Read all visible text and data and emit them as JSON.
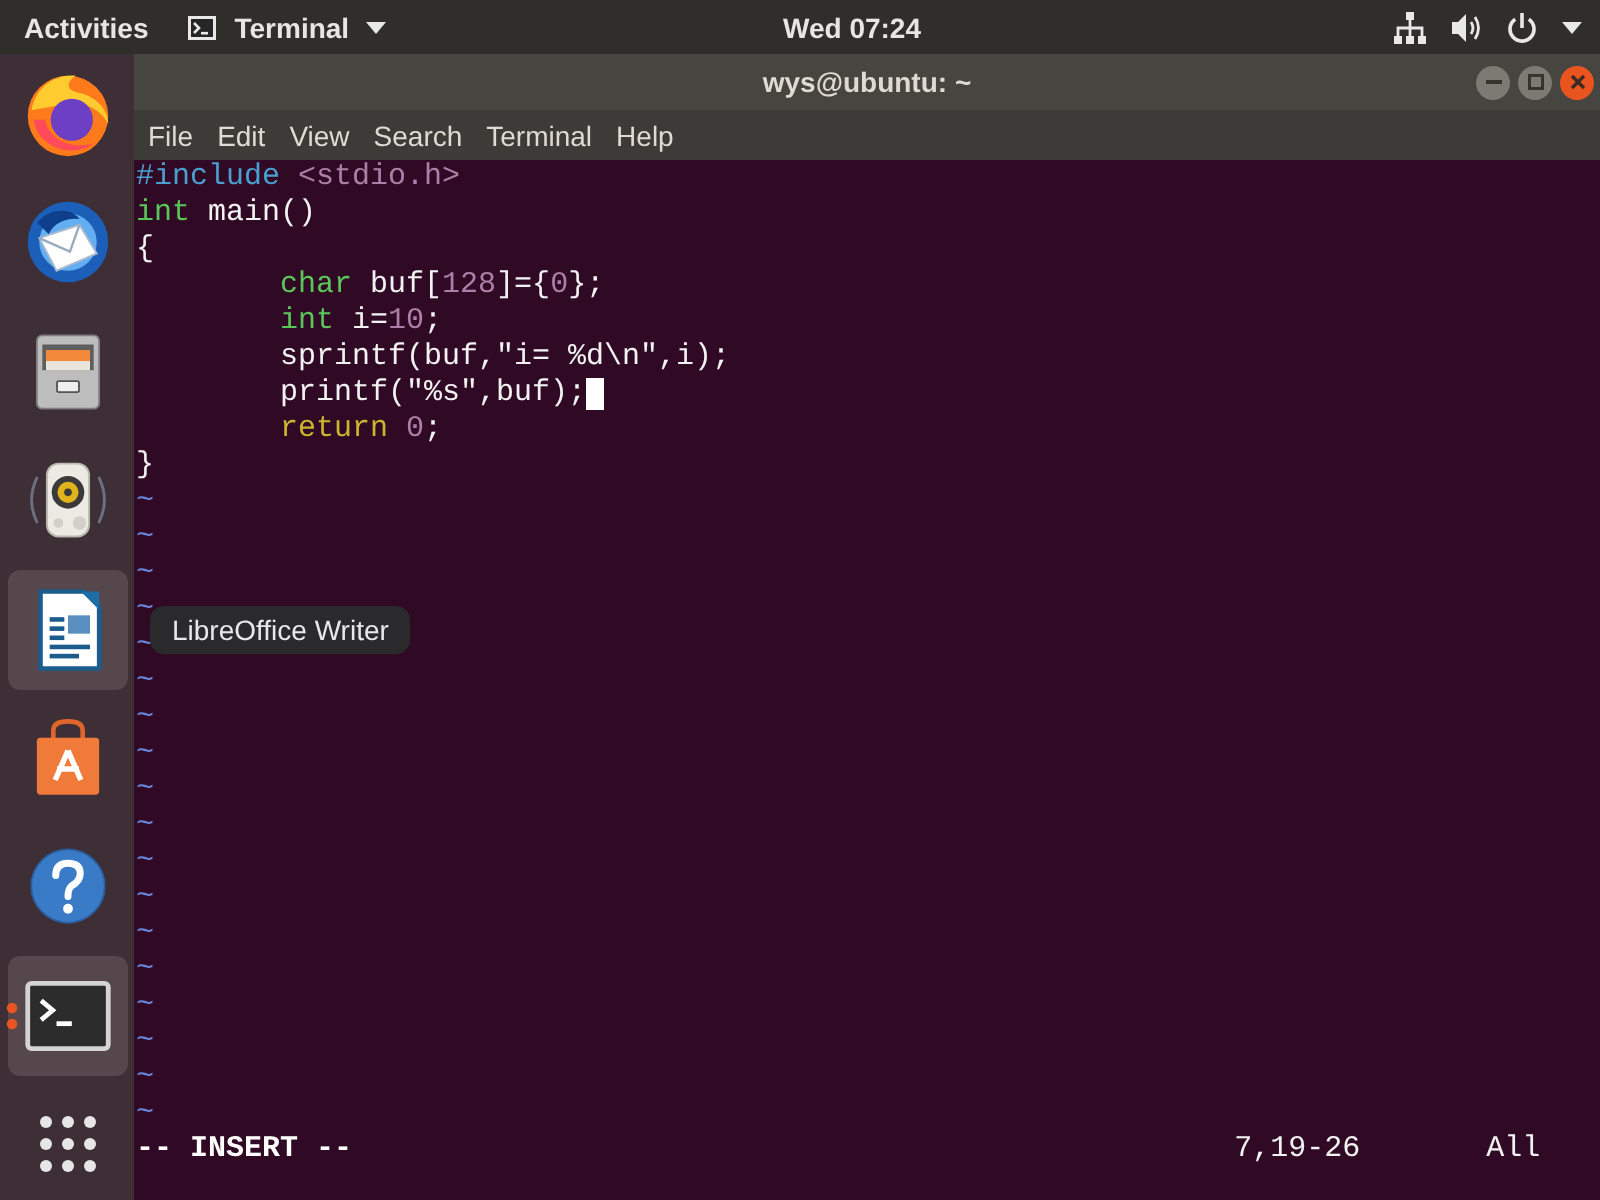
{
  "top_bar": {
    "activities": "Activities",
    "app_menu": "Terminal",
    "clock": "Wed 07:24"
  },
  "dock": {
    "items": [
      {
        "kind": "browser",
        "highlighted": false,
        "running": false
      },
      {
        "kind": "mail",
        "highlighted": false,
        "running": false
      },
      {
        "kind": "files",
        "highlighted": false,
        "running": false
      },
      {
        "kind": "music",
        "highlighted": false,
        "running": false
      },
      {
        "kind": "writer",
        "highlighted": true,
        "running": false
      },
      {
        "kind": "store",
        "highlighted": false,
        "running": false
      },
      {
        "kind": "help",
        "highlighted": false,
        "running": false
      },
      {
        "kind": "terminal",
        "highlighted": true,
        "running": true
      },
      {
        "kind": "apps",
        "highlighted": false,
        "running": false
      }
    ],
    "tooltip": "LibreOffice Writer"
  },
  "window": {
    "title": "wys@ubuntu: ~",
    "menu": [
      "File",
      "Edit",
      "View",
      "Search",
      "Terminal",
      "Help"
    ]
  },
  "editor": {
    "lines": [
      {
        "tokens": [
          {
            "text": "#include",
            "kind": "preproc"
          },
          {
            "text": " <stdio.h>",
            "kind": "include"
          }
        ]
      },
      {
        "tokens": [
          {
            "text": "int",
            "kind": "type"
          },
          {
            "text": " main()",
            "kind": "plain"
          }
        ]
      },
      {
        "tokens": [
          {
            "text": "{",
            "kind": "plain"
          }
        ],
        "children": [
          {
            "tokens": [
              {
                "text": "char",
                "kind": "type"
              },
              {
                "text": " buf[",
                "kind": "plain"
              },
              {
                "text": "128",
                "kind": "number"
              },
              {
                "text": "]={",
                "kind": "plain"
              },
              {
                "text": "0",
                "kind": "number"
              },
              {
                "text": "};",
                "kind": "plain"
              }
            ]
          },
          {
            "tokens": [
              {
                "text": "int",
                "kind": "type"
              },
              {
                "text": " i=",
                "kind": "plain"
              },
              {
                "text": "10",
                "kind": "number"
              },
              {
                "text": ";",
                "kind": "plain"
              }
            ]
          },
          {
            "tokens": [
              {
                "text": "sprintf(buf,\"i= %d\\n\",i);",
                "kind": "plain"
              }
            ]
          },
          {
            "tokens": [
              {
                "text": "printf(\"%s\",buf);",
                "kind": "plain"
              }
            ],
            "cursor": true
          },
          {
            "tokens": [
              {
                "text": "return",
                "kind": "statement"
              },
              {
                "text": " 0",
                "kind": "number"
              },
              {
                "text": ";",
                "kind": "plain"
              }
            ]
          }
        ]
      },
      {
        "tokens": [
          {
            "text": "}",
            "kind": "plain"
          }
        ]
      }
    ],
    "empty_lines": [
      "~",
      "~",
      "~",
      "~",
      "~",
      "~",
      "~",
      "~",
      "~",
      "~",
      "~",
      "~",
      "~",
      "~",
      "~",
      "~",
      "~",
      "~"
    ],
    "mode": "-- INSERT --",
    "position": "7,19-26",
    "scroll": "All"
  }
}
